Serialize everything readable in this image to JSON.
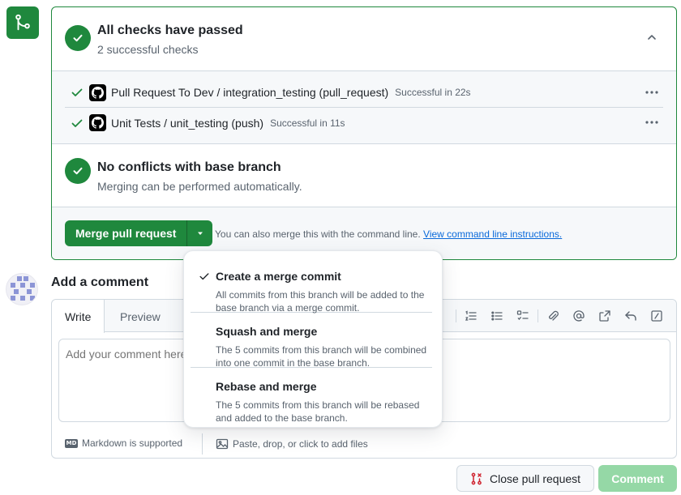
{
  "checks_section": {
    "title": "All checks have passed",
    "subtitle": "2 successful checks",
    "items": [
      {
        "name": "Pull Request To Dev / integration_testing (pull_request)",
        "status": "Successful in 22s"
      },
      {
        "name": "Unit Tests / unit_testing (push)",
        "status": "Successful in 11s"
      }
    ]
  },
  "conflicts_section": {
    "title": "No conflicts with base branch",
    "subtitle": "Merging can be performed automatically."
  },
  "merge_section": {
    "button_label": "Merge pull request",
    "hint_text": "You can also merge this with the command line.",
    "link_text": "View command line instructions."
  },
  "merge_options": [
    {
      "title": "Create a merge commit",
      "description": "All commits from this branch will be added to the base branch via a merge commit.",
      "selected": true
    },
    {
      "title": "Squash and merge",
      "description": "The 5 commits from this branch will be combined into one commit in the base branch.",
      "selected": false
    },
    {
      "title": "Rebase and merge",
      "description": "The 5 commits from this branch will be rebased and added to the base branch.",
      "selected": false
    }
  ],
  "comment": {
    "heading": "Add a comment",
    "tabs": [
      "Write",
      "Preview"
    ],
    "placeholder": "Add your comment here...",
    "markdown_hint": "Markdown is supported",
    "markdown_badge": "MD",
    "attach_hint": "Paste, drop, or click to add files"
  },
  "actions": {
    "close_label": "Close pull request",
    "comment_label": "Comment"
  },
  "colors": {
    "success": "#1f883d",
    "link": "#0969da",
    "comment_disabled": "#95d8a6",
    "close_icon": "#cf222e"
  },
  "icons": [
    "merge-icon",
    "check-circle-icon",
    "chevron-up-icon",
    "check-icon",
    "github-logo-icon",
    "kebab-icon",
    "triangle-down-icon",
    "avatar-identicon"
  ]
}
